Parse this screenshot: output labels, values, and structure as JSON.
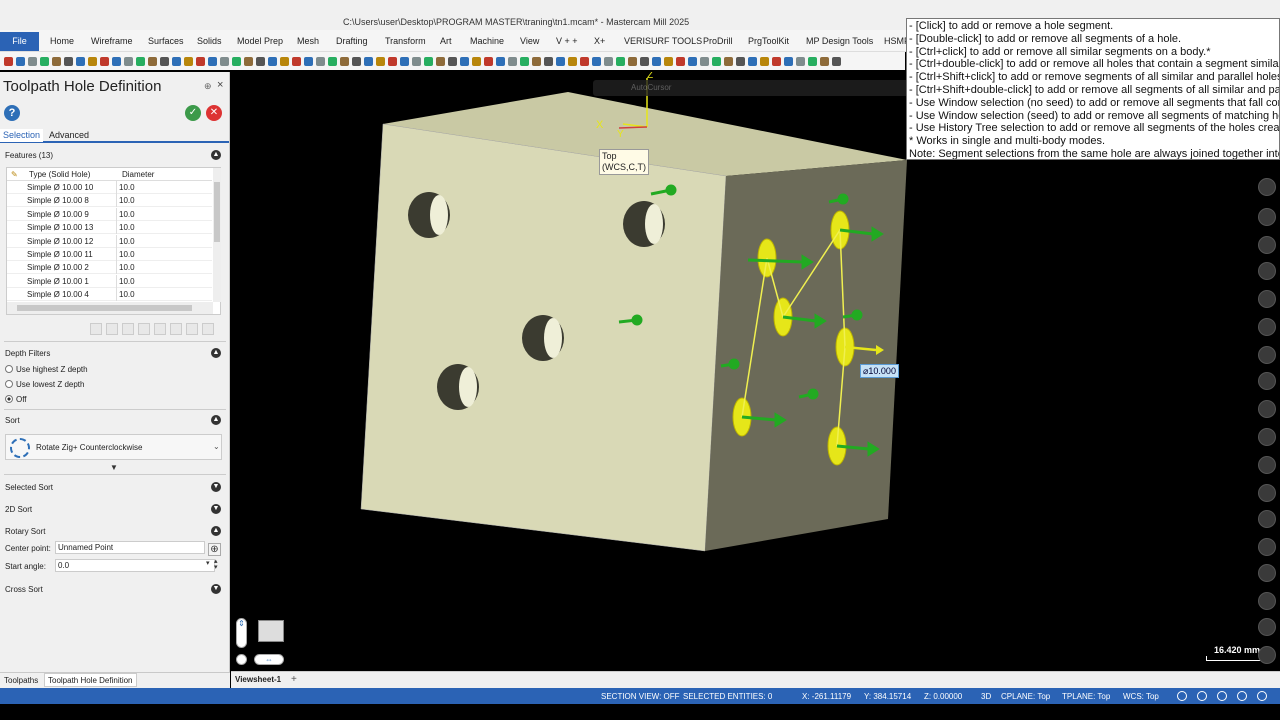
{
  "window": {
    "title": "C:\\Users\\user\\Desktop\\PROGRAM MASTER\\traning\\tn1.mcam* - Mastercam Mill 2025"
  },
  "menu": {
    "file": "File",
    "items": [
      "Home",
      "Wireframe",
      "Surfaces",
      "Solids",
      "Model Prep",
      "Mesh",
      "Drafting",
      "Transform",
      "Art",
      "Machine",
      "View",
      "V + +",
      "X+",
      "VERISURF TOOLS",
      "ProDrill",
      "PrgToolKit",
      "MP Design Tools",
      "HSMP"
    ]
  },
  "panel": {
    "title": "Toolpath Hole Definition",
    "pin": "⊕",
    "close": "×",
    "help": "?",
    "tabs": [
      "Selection",
      "Advanced"
    ],
    "features_header": "Features (13)",
    "columns": [
      "Type (Solid Hole)",
      "Diameter"
    ],
    "rows": [
      {
        "type": "Simple Ø 10.00 10",
        "diameter": "10.0"
      },
      {
        "type": "Simple Ø 10.00 8",
        "diameter": "10.0"
      },
      {
        "type": "Simple Ø 10.00 9",
        "diameter": "10.0"
      },
      {
        "type": "Simple Ø 10.00 13",
        "diameter": "10.0"
      },
      {
        "type": "Simple Ø 10.00 12",
        "diameter": "10.0"
      },
      {
        "type": "Simple Ø 10.00 11",
        "diameter": "10.0"
      },
      {
        "type": "Simple Ø 10.00 2",
        "diameter": "10.0"
      },
      {
        "type": "Simple Ø 10.00 1",
        "diameter": "10.0"
      },
      {
        "type": "Simple Ø 10.00 4",
        "diameter": "10.0"
      }
    ],
    "depth_filters": "Depth Filters",
    "depth_options": [
      "Use highest Z depth",
      "Use lowest Z depth",
      "Off"
    ],
    "depth_selected": "Off",
    "sort": "Sort",
    "sort_value": "Rotate Zig+ Counterclockwise",
    "selected_sort": "Selected Sort",
    "sort_2d": "2D Sort",
    "rotary_sort": "Rotary Sort",
    "center_point_label": "Center point:",
    "center_point_value": "Unnamed Point",
    "start_angle_label": "Start angle:",
    "start_angle_value": "0.0",
    "cross_sort": "Cross Sort"
  },
  "bottom_tabs": [
    "Toolpaths",
    "Toolpath Hole Definition"
  ],
  "viewport": {
    "view_label_line1": "Top",
    "view_label_line2": "(WCS,C,T)",
    "dimension": "⌀10.000",
    "scale": "16.420 mm",
    "autocursor": "AutoCursor",
    "gnomon_x": "X",
    "gnomon_y": "Y",
    "gnomon_z": "Z"
  },
  "tooltip": {
    "lines": [
      "- [Click] to add or remove a hole segment.",
      "- [Double-click] to add or remove all segments of a hole.",
      "- [Ctrl+click] to add or remove all similar segments on a body.*",
      "- [Ctrl+double-click] to add or remove all holes that contain a segment similar",
      "- [Ctrl+Shift+click] to add or remove segments of all similar and parallel holes",
      "- [Ctrl+Shift+double-click] to add or remove all segments of all similar and pa",
      "- Use Window selection (no seed) to add or remove all segments that fall comp",
      "- Use Window selection (seed) to add or remove all segments of matching hole",
      "- Use History Tree selection to add or remove all segments of the holes created",
      "* Works in single and multi-body modes.",
      "Note: Segment selections from the same hole are always joined together into a"
    ]
  },
  "viewsheet": {
    "tab": "Viewsheet-1",
    "add": "+"
  },
  "status": {
    "section_view": "SECTION VIEW: OFF",
    "selected": "SELECTED ENTITIES: 0",
    "x": "X:  -261.11179",
    "y": "Y:  384.15714",
    "z": "Z:  0.00000",
    "mode": "3D",
    "cplane": "CPLANE: Top",
    "tplane": "TPLANE: Top",
    "wcs": "WCS: Top"
  },
  "colors": {
    "accent": "#2b63b5",
    "block_front": "#d9d9b6",
    "block_side": "#6b6a58",
    "hole_selected": "#e6e619",
    "arrow": "#22aa22"
  }
}
